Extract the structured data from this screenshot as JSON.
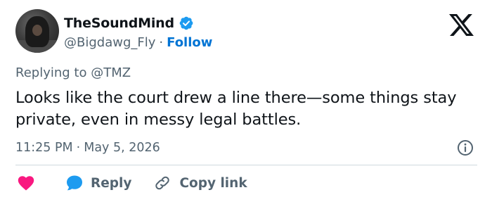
{
  "user": {
    "display_name": "TheSoundMind",
    "handle": "@Bigdawg_Fly",
    "separator": "·",
    "follow_label": "Follow"
  },
  "reply_context": {
    "prefix": "Replying to",
    "mention": "@TMZ"
  },
  "tweet": {
    "text": "Looks like the court drew a line there—some things stay private, even in messy legal battles.",
    "time": "11:25 PM",
    "separator": "·",
    "date": "May 5, 2026"
  },
  "actions": {
    "reply_label": "Reply",
    "copy_link_label": "Copy link"
  },
  "icons": {
    "verified": "verified-badge-icon",
    "logo": "x-logo-icon",
    "info": "info-icon",
    "like": "heart-icon",
    "reply": "speech-bubble-icon",
    "copy_link": "link-icon"
  },
  "colors": {
    "accent": "#0074d4",
    "verified": "#1d9bf0",
    "heart": "#f91880",
    "secondary_text": "#536471",
    "text": "#0f1419",
    "divider": "#cfd9de"
  }
}
